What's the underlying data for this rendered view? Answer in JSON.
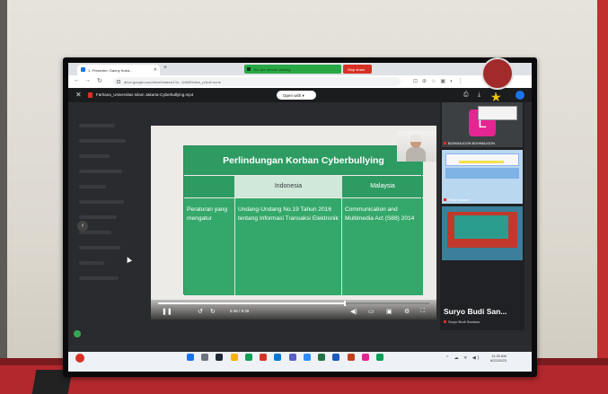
{
  "browser": {
    "tab_title": "1. Presenter: Danny Nuha...",
    "sharing_notice": "You are remote sharing",
    "stop_share_label": "Stop share",
    "url": "drive.google.com/drive/folders/1Yo...D6MR/view_pr&dl=none"
  },
  "viewer": {
    "file_name": "Farhana_Universitas Islam Jakarta-Cyberbullying.mp4",
    "open_with_label": "Open with",
    "time_display": "5:48 / 8:38",
    "progress_fraction": 0.69
  },
  "slide": {
    "title": "Perlindungan Korban Cyberbullying",
    "col_headers": [
      "Indonesia",
      "Malaysia"
    ],
    "row_label": "Peraturan yang mengatur",
    "cells": [
      "Undang-Undang No.19 Tahun 2016 tentang Informasi Transaksi Elektronik",
      "Communication and Multimedia Act (S88) 2014"
    ]
  },
  "participants": {
    "tile1_initial": "L",
    "tile1_name": "BOHIMAJOON BOHIMAJOON",
    "tile2_name": "Ruby Kautsch",
    "tile3_name": "Suryo Budi San...",
    "tile3_small_name": "Suryo Budi Santoso"
  },
  "taskbar": {
    "clock_time": "11:25 AM",
    "clock_date": "6/22/2023"
  },
  "colors": {
    "slide_green": "#2e9b63",
    "share_green": "#27a844",
    "stop_red": "#d93025",
    "avatar_pink": "#e52592"
  }
}
